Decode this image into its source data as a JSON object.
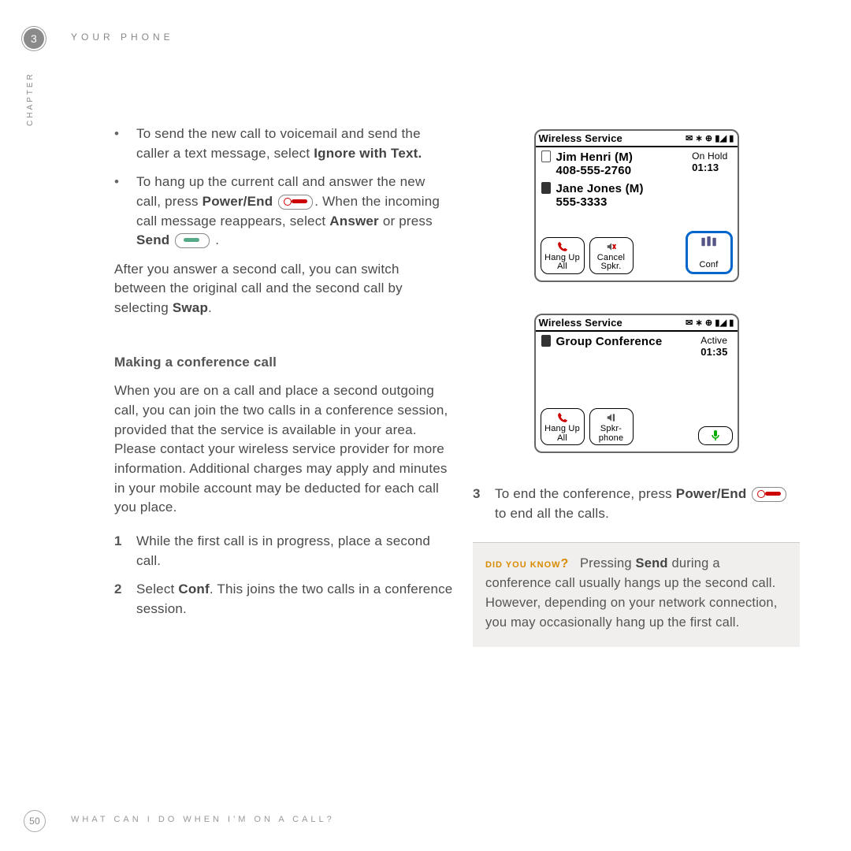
{
  "header": {
    "chapter_number": "3",
    "chapter_word": "CHAPTER",
    "title": "YOUR PHONE"
  },
  "left": {
    "bullet1_a": "To send the new call to voicemail and send the caller a text message, select ",
    "bullet1_bold": "Ignore with Text.",
    "bullet2_a": "To hang up the current call and answer the new call, press ",
    "bullet2_bold1": "Power/End",
    "bullet2_b": ". When the incoming call message reappears, select ",
    "bullet2_bold2": "Answer",
    "bullet2_c": " or press ",
    "bullet2_bold3": "Send",
    "bullet2_d": " .",
    "after_para_a": "After you answer a second call, you can switch between the original call and the second call by selecting ",
    "after_para_bold": "Swap",
    "after_para_b": ".",
    "subheading": "Making a conference call",
    "conf_para": "When you are on a call and place a second outgoing call, you can join the two calls in a conference session, provided that the service is available in your area. Please contact your wireless service provider for more information. Additional charges may apply and minutes in your mobile account may be deducted for each call you place.",
    "step1_num": "1",
    "step1": "While the first call is in progress, place a second call.",
    "step2_num": "2",
    "step2_a": "Select ",
    "step2_bold": "Conf",
    "step2_b": ". This joins the two calls in a conference session."
  },
  "screen1": {
    "status_title": "Wireless Service",
    "call1_name": "Jim Henri (M)",
    "call1_num": "408-555-2760",
    "call1_status": "On Hold",
    "call1_time": "01:13",
    "call2_name": "Jane Jones (M)",
    "call2_num": "555-3333",
    "btn_hang": "Hang Up All",
    "btn_cancel": "Cancel Spkr.",
    "btn_conf": "Conf"
  },
  "screen2": {
    "status_title": "Wireless Service",
    "group_label": "Group Conference",
    "group_status": "Active",
    "group_time": "01:35",
    "btn_hang": "Hang Up All",
    "btn_spkr": "Spkr-phone"
  },
  "right": {
    "step3_num": "3",
    "step3_a": "To end the conference, press ",
    "step3_bold": "Power/End",
    "step3_b": " to end all the calls."
  },
  "tip": {
    "label": "DID YOU KNOW",
    "q": "?",
    "text_a": "Pressing ",
    "text_bold": "Send",
    "text_b": " during a conference call usually hangs up the second call. However, depending on your network connection, you may occasionally hang up the first call."
  },
  "footer": {
    "page": "50",
    "text": "WHAT CAN I DO WHEN I'M ON A CALL?"
  }
}
